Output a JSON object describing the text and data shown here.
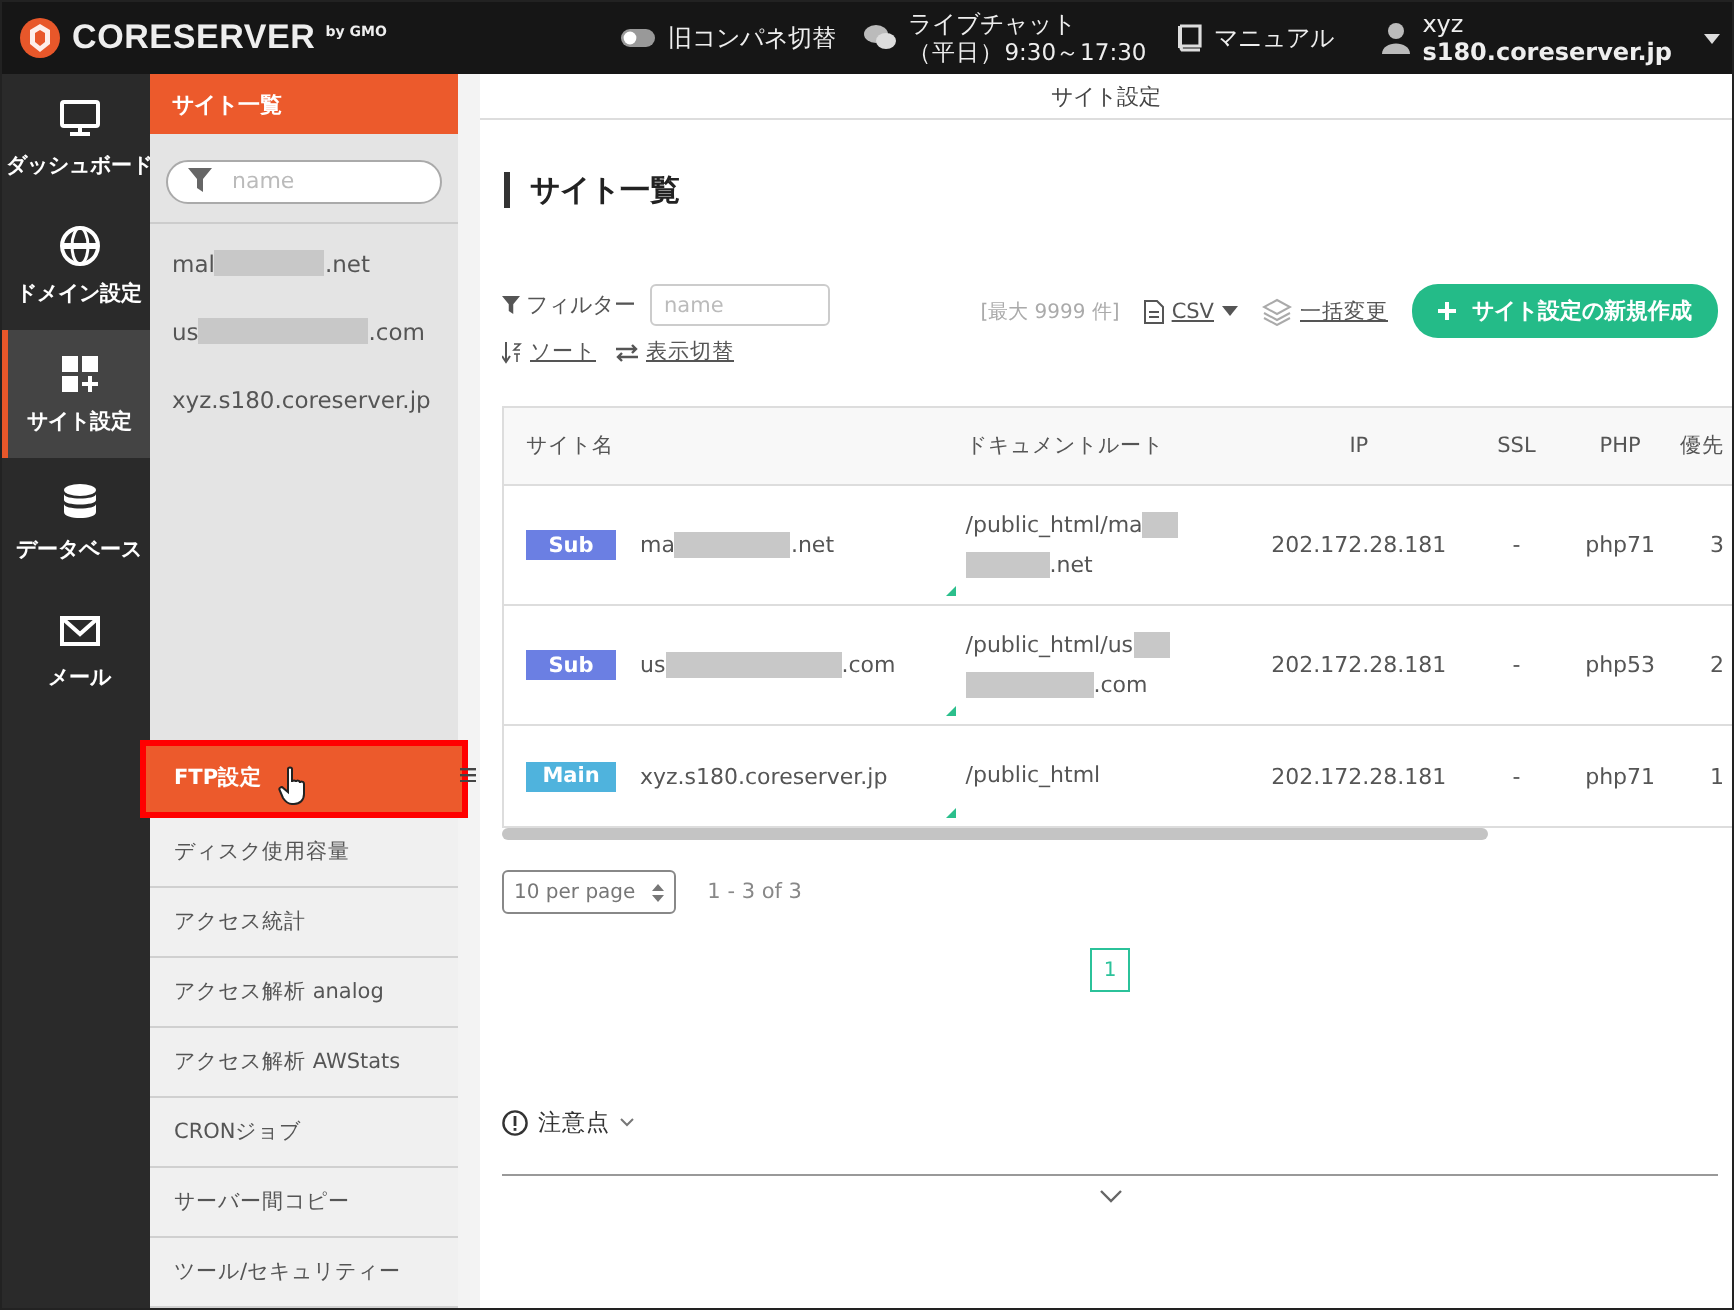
{
  "header": {
    "logo": "CORESERVER",
    "logo_sub": "by GMO",
    "legacy_toggle": {
      "label": "旧コンパネ切替",
      "on": false
    },
    "chat": {
      "label": "ライブチャット",
      "hours": "（平日）9:30～17:30"
    },
    "manual": "マニュアル",
    "user": {
      "name": "xyz",
      "host": "s180.coreserver.jp"
    }
  },
  "nav": {
    "items": [
      {
        "label": "ダッシュボード",
        "selected": false
      },
      {
        "label": "ドメイン設定",
        "selected": false
      },
      {
        "label": "サイト設定",
        "selected": true
      },
      {
        "label": "データベース",
        "selected": false
      },
      {
        "label": "メール",
        "selected": false
      }
    ]
  },
  "subnav": {
    "title": "サイト一覧",
    "search_placeholder": "name",
    "sites": [
      {
        "start": "mal",
        "end": ".net",
        "redacted": true
      },
      {
        "start": "us",
        "end": ".com",
        "redacted": true
      },
      {
        "start": "xyz.s180.coreserver.jp",
        "redacted": false
      }
    ],
    "menu": [
      {
        "label": "FTP設定",
        "selected": true
      },
      {
        "label": "ディスク使用容量",
        "selected": false
      },
      {
        "label": "アクセス統計",
        "selected": false
      },
      {
        "label": "アクセス解析 analog",
        "selected": false
      },
      {
        "label": "アクセス解析 AWStats",
        "selected": false
      },
      {
        "label": "CRONジョブ",
        "selected": false
      },
      {
        "label": "サーバー間コピー",
        "selected": false
      },
      {
        "label": "ツール/セキュリティー",
        "selected": false
      }
    ]
  },
  "content": {
    "topbar_title": "サイト設定",
    "page_title": "サイト一覧",
    "filter_label": "フィルター",
    "filter_placeholder": "name",
    "max_count": "[最大 9999 件]",
    "csv": "CSV",
    "bulk": "一括変更",
    "create_button": "サイト設定の新規作成",
    "sort": "ソート",
    "view_toggle": "表示切替",
    "table": {
      "columns": [
        "サイト名",
        "ドキュメントルート",
        "IP",
        "SSL",
        "PHP",
        "優先"
      ],
      "rows": [
        {
          "badge": "Sub",
          "kind": "sub",
          "name_start": "ma",
          "name_end": ".net",
          "root_start": "/public_html/ma",
          "root_end": ".net",
          "redacted": true,
          "ip": "202.172.28.181",
          "ssl": "-",
          "php": "php71",
          "priority": "3"
        },
        {
          "badge": "Sub",
          "kind": "sub",
          "name_start": "us",
          "name_end": ".com",
          "root_start": "/public_html/us",
          "root_end": ".com",
          "redacted": true,
          "ip": "202.172.28.181",
          "ssl": "-",
          "php": "php53",
          "priority": "2"
        },
        {
          "badge": "Main",
          "kind": "main",
          "name_start": "xyz.s180.coreserver.jp",
          "root_start": "/public_html",
          "redacted": false,
          "ip": "202.172.28.181",
          "ssl": "-",
          "php": "php71",
          "priority": "1"
        }
      ]
    },
    "per_page": "10 per page",
    "range": "1 - 3 of 3",
    "pages": [
      {
        "label": "1",
        "selected": true
      }
    ],
    "notes_label": "注意点"
  }
}
